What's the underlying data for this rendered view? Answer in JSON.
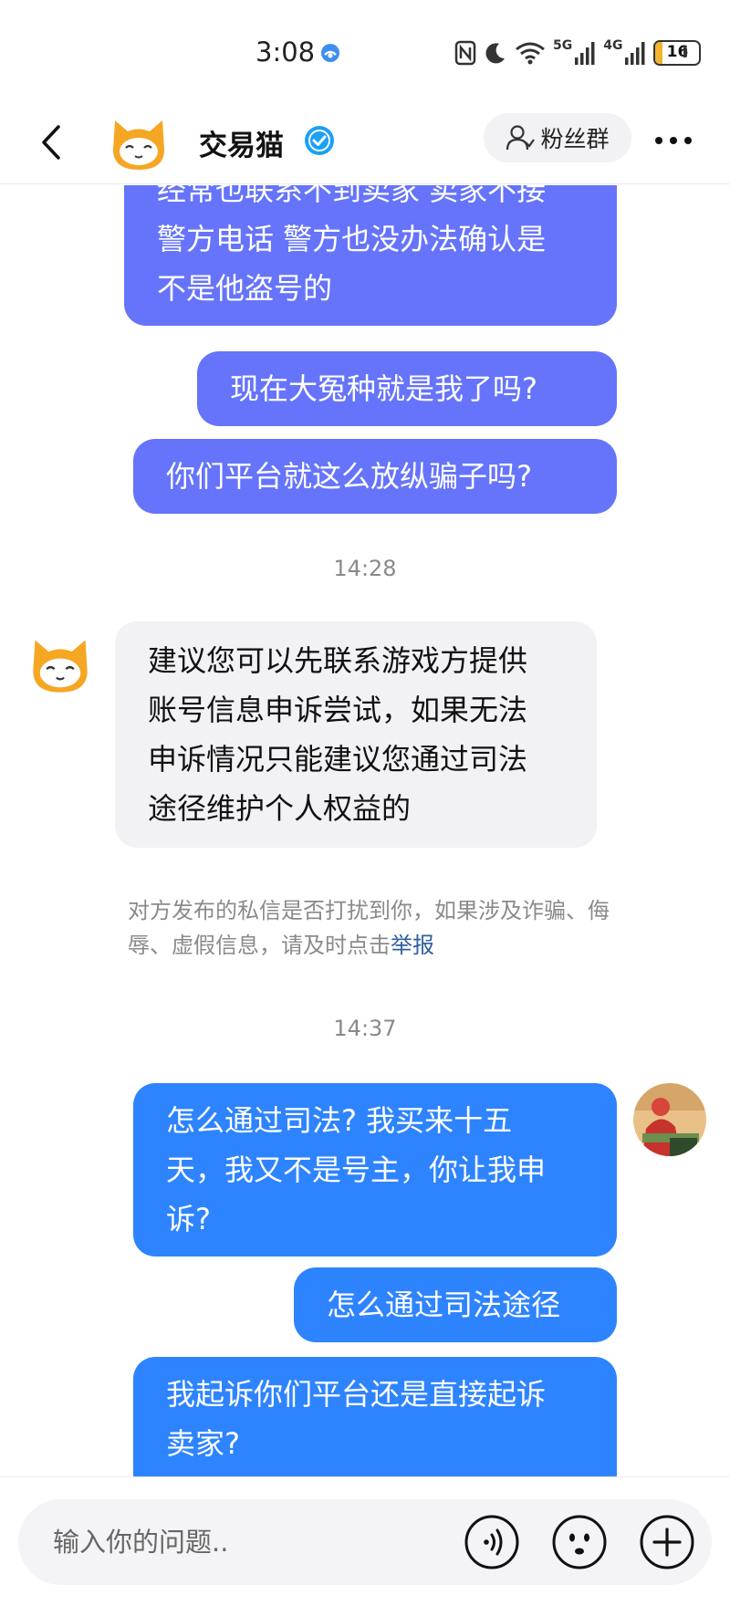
{
  "status_bar": {
    "time": "3:08",
    "network_5g": "5G",
    "network_4g": "4G",
    "battery_level": "16",
    "battery_fraction": 0.16
  },
  "header": {
    "title": "交易猫",
    "fans_group_label": "粉丝群"
  },
  "messages": {
    "m1": "经常也联系不到卖家 卖家不接\n警方电话 警方也没办法确认是\n不是他盗号的",
    "m2": "现在大冤种就是我了吗?",
    "m3": "你们平台就这么放纵骗子吗?",
    "time1": "14:28",
    "m4": "建议您可以先联系游戏方提供\n账号信息申诉尝试，如果无法\n申诉情况只能建议您通过司法\n途径维护个人权益的",
    "notice_text": "对方发布的私信是否打扰到你，如果涉及诈骗、侮辱、虚假信息，请及时点击",
    "notice_link": "举报",
    "time2": "14:37",
    "m5": "怎么通过司法? 我买来十五\n天，我又不是号主，你让我申\n诉?",
    "m6": "怎么通过司法途径",
    "m7": "我起诉你们平台还是直接起诉\n卖家?"
  },
  "input": {
    "placeholder": "输入你的问题.."
  },
  "colors": {
    "purple_bubble": "#6674fb",
    "blue_bubble": "#2e84ff",
    "grey_bubble": "#f2f2f5",
    "verified_blue": "#1aa0f5",
    "cat_orange": "#f5a623"
  }
}
